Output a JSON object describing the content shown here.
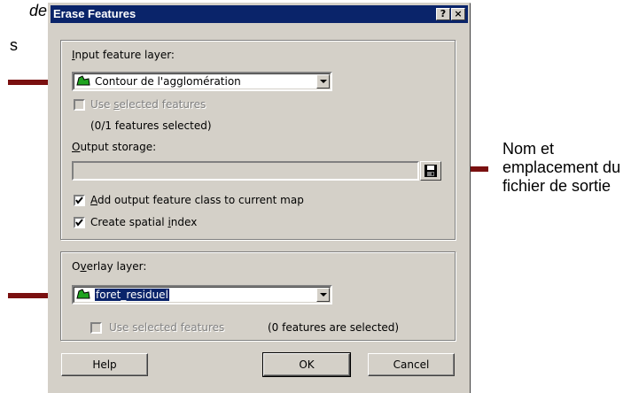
{
  "annotations": {
    "fragment_top": "de",
    "fragment_second": "s",
    "side_note": "Nom et emplacement du fichier de sortie"
  },
  "dialog": {
    "title": "Erase Features",
    "title_help": "?",
    "title_close": "×",
    "input_label_u": "I",
    "input_label_rest": "nput feature layer:",
    "input_value": "Contour de l'agglomération",
    "use_selected_1_pre": "Use ",
    "use_selected_1_u": "s",
    "use_selected_1_post": "elected features",
    "selected_count_1": "(0/1 features selected)",
    "output_label_u": "O",
    "output_label_rest": "utput storage:",
    "output_value": "",
    "add_output_u": "A",
    "add_output_rest": "dd output feature class to current map",
    "add_output_checked": true,
    "spatial_pre": "Create spatial ",
    "spatial_u": "i",
    "spatial_post": "ndex",
    "spatial_checked": true,
    "overlay_pre": "O",
    "overlay_u": "v",
    "overlay_post": "erlay layer:",
    "overlay_value": "foret_residuel",
    "use_selected_2": "Use selected features",
    "selected_count_2": "(0 features are selected)",
    "help_button": "Help",
    "ok_button": "OK",
    "cancel_button": "Cancel"
  },
  "colors": {
    "title_bar": "#0a246a",
    "dialog_face": "#d4d0c8",
    "arrow": "#7a1010",
    "layer_icon_green": "#1fa31f"
  }
}
